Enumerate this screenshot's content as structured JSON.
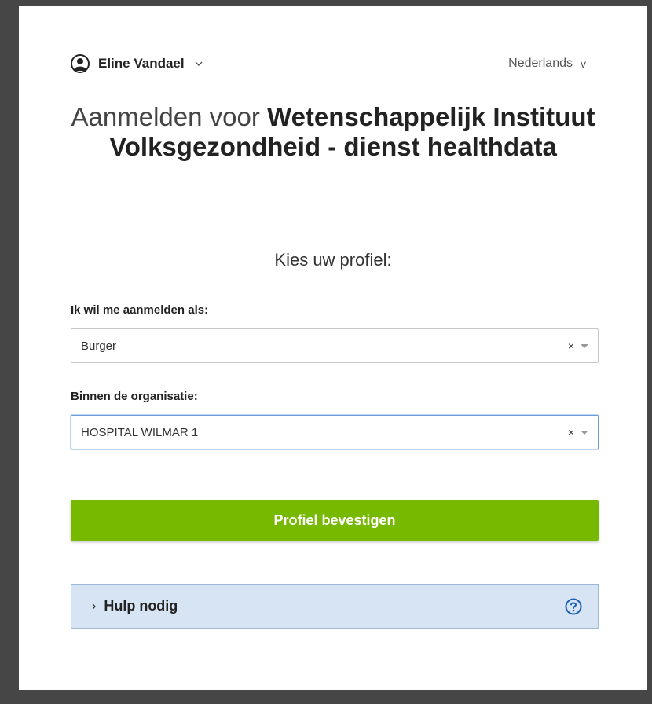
{
  "user": {
    "name": "Eline Vandael"
  },
  "language": {
    "selected": "Nederlands",
    "chevron": "v"
  },
  "title": {
    "prefix": "Aanmelden voor",
    "organization": "Wetenschappelijk Instituut Volksgezondheid - dienst healthdata"
  },
  "subtitle": "Kies uw profiel:",
  "profile_field": {
    "label": "Ik wil me aanmelden als:",
    "value": "Burger",
    "clear": "×"
  },
  "organization_field": {
    "label": "Binnen de organisatie:",
    "value": "HOSPITAL WILMAR 1",
    "clear": "×"
  },
  "confirm_button": {
    "label": "Profiel bevestigen"
  },
  "help": {
    "chevron": "›",
    "label": "Hulp nodig"
  },
  "colors": {
    "accent_green": "#76b900",
    "help_background": "#d7e4f3",
    "help_icon": "#1a5fb4"
  }
}
